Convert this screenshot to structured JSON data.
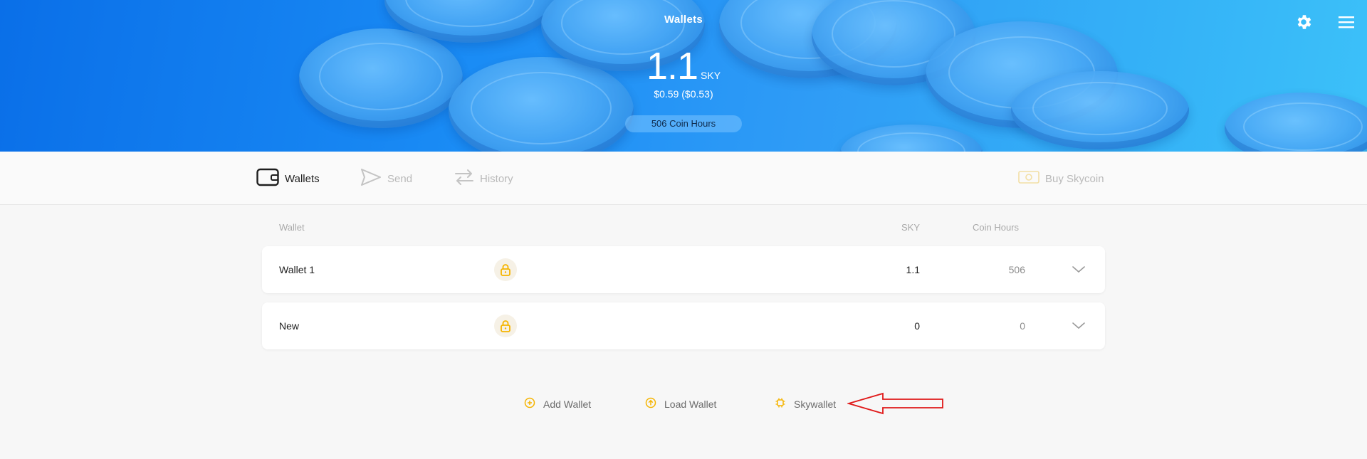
{
  "header": {
    "title": "Wallets",
    "balance": "1.1",
    "unit": "SKY",
    "fiat": "$0.59 ($0.53)",
    "coin_hours_pill": "506 Coin Hours",
    "settings_icon": "gear-icon",
    "menu_icon": "hamburger-menu-icon"
  },
  "nav": {
    "wallets": "Wallets",
    "send": "Send",
    "history": "History",
    "buy": "Buy Skycoin"
  },
  "table": {
    "headers": {
      "wallet": "Wallet",
      "sky": "SKY",
      "coin_hours": "Coin Hours"
    },
    "rows": [
      {
        "name": "Wallet 1",
        "sky": "1.1",
        "coin_hours": "506",
        "lock_icon": "lock-icon"
      },
      {
        "name": "New",
        "sky": "0",
        "coin_hours": "0",
        "lock_icon": "lock-icon"
      }
    ]
  },
  "actions": {
    "add_wallet": "Add Wallet",
    "load_wallet": "Load Wallet",
    "skywallet": "Skywallet"
  },
  "colors": {
    "header_blue": "#1a8cf5",
    "accent_yellow": "#f5b400",
    "annotation_red": "#e01818"
  }
}
